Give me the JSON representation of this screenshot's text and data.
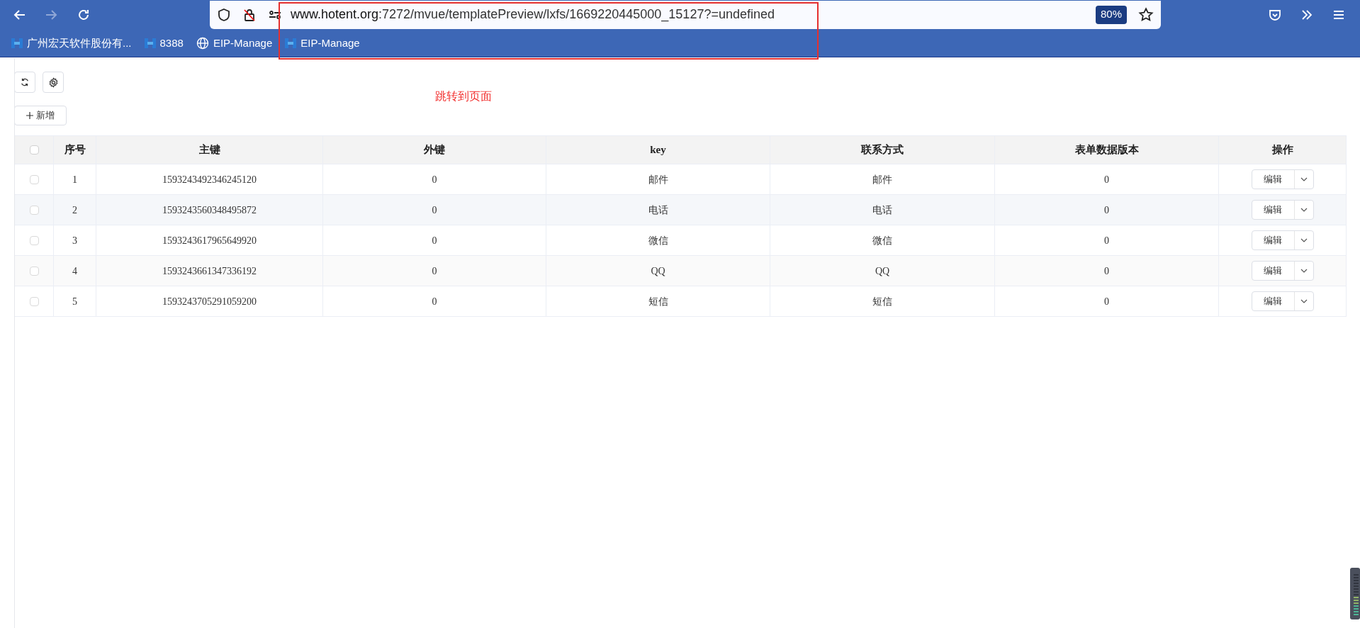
{
  "browser": {
    "url_host": "www.hotent.org",
    "url_path": ":7272/mvue/templatePreview/lxfs/1669220445000_15127?=undefined",
    "zoom": "80%",
    "bookmarks": [
      {
        "kind": "app",
        "label": "广州宏天软件股份有..."
      },
      {
        "kind": "app",
        "label": "8388"
      },
      {
        "kind": "globe",
        "label": "EIP-Manage"
      },
      {
        "kind": "app",
        "label": "EIP-Manage"
      }
    ]
  },
  "annotation": "跳转到页面",
  "toolbar": {
    "add_button": "新增"
  },
  "table": {
    "select_all_checked": false,
    "columns": [
      "序号",
      "主键",
      "外键",
      "key",
      "联系方式",
      "表单数据版本",
      "操作"
    ],
    "rows": [
      {
        "cells": [
          "1",
          "1593243492346245120",
          "0",
          "邮件",
          "邮件",
          "0"
        ],
        "action": "编辑",
        "checked": false
      },
      {
        "cells": [
          "2",
          "1593243560348495872",
          "0",
          "电话",
          "电话",
          "0"
        ],
        "action": "编辑",
        "checked": false
      },
      {
        "cells": [
          "3",
          "1593243617965649920",
          "0",
          "微信",
          "微信",
          "0"
        ],
        "action": "编辑",
        "checked": false
      },
      {
        "cells": [
          "4",
          "1593243661347336192",
          "0",
          "QQ",
          "QQ",
          "0"
        ],
        "action": "编辑",
        "checked": false
      },
      {
        "cells": [
          "5",
          "1593243705291059200",
          "0",
          "短信",
          "短信",
          "0"
        ],
        "action": "编辑",
        "checked": false
      }
    ]
  }
}
